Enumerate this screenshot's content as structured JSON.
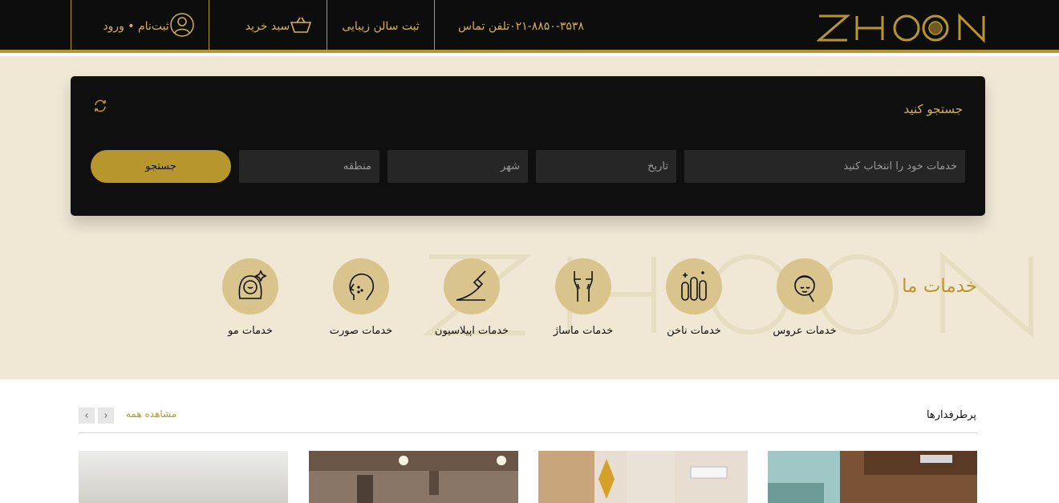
{
  "header": {
    "logo_text": "ZHOON",
    "phone_label": "تلفن تماس",
    "phone_number": "۰۲۱-۸۸۵۰-۳۵۳۸",
    "register_salon": "ثبت سالن زیبایی",
    "cart": "سبد خرید",
    "auth": "ثبت‌نام • ورود"
  },
  "search": {
    "title": "جستجو کنید",
    "services_placeholder": "خدمات خود را انتخاب کنید",
    "date_placeholder": "تاریخ",
    "city_placeholder": "شهر",
    "area_placeholder": "منطقه",
    "button": "جستجو"
  },
  "services": {
    "title": "خدمات ما",
    "items": [
      {
        "label": "خدمات عروس",
        "icon": "bride-icon"
      },
      {
        "label": "خدمات ناخن",
        "icon": "nail-icon"
      },
      {
        "label": "خدمات ماساژ",
        "icon": "massage-icon"
      },
      {
        "label": "خدمات اپیلاسیون",
        "icon": "epilation-icon"
      },
      {
        "label": "خدمات صورت",
        "icon": "face-icon"
      },
      {
        "label": "خدمات مو",
        "icon": "hair-icon"
      }
    ]
  },
  "bestsellers": {
    "title": "پرطرفدارها",
    "see_all": "مشاهده همه"
  },
  "colors": {
    "gold": "#b8962e",
    "dark": "#0d0d0d",
    "cream": "#f0e8d5"
  }
}
